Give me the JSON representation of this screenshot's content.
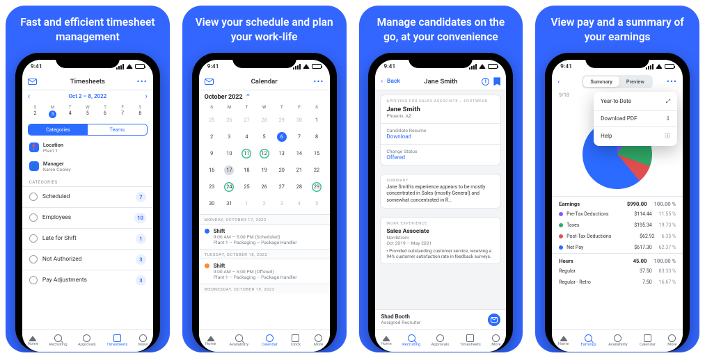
{
  "status_time": "9:41",
  "panels": [
    {
      "headline": "Fast and efficient timesheet management"
    },
    {
      "headline": "View your schedule and plan your work-life"
    },
    {
      "headline": "Manage candidates on the go, at your convenience"
    },
    {
      "headline": "View pay and a summary of your earnings"
    }
  ],
  "timesheets": {
    "title": "Timesheets",
    "range": "Oct 2 – 8, 2022",
    "week_days": [
      "S",
      "M",
      "T",
      "W",
      "T",
      "F",
      "S"
    ],
    "week_dates": [
      "2",
      "3",
      "4",
      "5",
      "6",
      "7",
      "8"
    ],
    "today_index": 1,
    "segments": {
      "left": "Categories",
      "right": "Teams"
    },
    "info": [
      {
        "icon": "📍",
        "label": "Location",
        "value": "Plant 1"
      },
      {
        "icon": "👤",
        "label": "Manager",
        "value": "Karen Cooley"
      }
    ],
    "cat_caption": "CATEGORIES",
    "categories": [
      {
        "name": "Scheduled",
        "count": "7"
      },
      {
        "name": "Employees",
        "count": "10"
      },
      {
        "name": "Late for Shift",
        "count": "1"
      },
      {
        "name": "Not Authorized",
        "count": "3"
      },
      {
        "name": "Pay Adjustments",
        "count": "3"
      }
    ],
    "tabs": [
      "Home",
      "Recruiting",
      "Approvals",
      "Timesheets",
      "More"
    ],
    "active_tab": 3
  },
  "calendar": {
    "title": "Calendar",
    "month": "October 2022",
    "dow": [
      "S",
      "M",
      "T",
      "W",
      "T",
      "F",
      "S"
    ],
    "agenda": [
      {
        "caption": "MONDAY, OCTOBER 17, 2022",
        "color": "blue",
        "title": "Shift",
        "sub1": "9:00 AM – 5:00 PM (Scheduled)",
        "sub2": "Plant 1 – Packaging – Package Handler"
      },
      {
        "caption": "TUESDAY, OCTOBER 18, 2022",
        "color": "orange",
        "title": "Shift",
        "sub1": "9:00 AM – 5:00 PM (Offered)",
        "sub2": "Plant 1 – Packaging – Package Handler"
      },
      {
        "caption": "WEDNESDAY, OCTOBER 19, 2022"
      }
    ],
    "tabs": [
      "Home",
      "Availability",
      "Calendar",
      "Clock",
      "More"
    ],
    "active_tab": 2
  },
  "candidate": {
    "back": "Back",
    "title": "Jane Smith",
    "applying_caption": "APPLYING FOR SALES ASSOCIATE – FOOTWEAR",
    "name": "Jane Smith",
    "location": "Phoenix, AZ",
    "resume_label": "Candidate Resume",
    "resume_link": "Download",
    "status_label": "Change Status",
    "status_value": "Offered",
    "summary_caption": "SUMMARY",
    "summary_text": "Jane Smith's experience appears to be mostly concentrated in Sales (mostly General) and somewhat concentrated in R…",
    "work_caption": "WORK EXPERIENCE",
    "work_title": "Sales Associate",
    "work_company": "Nordstrom",
    "work_dates": "Oct 2019 – May 2021",
    "work_bullet": "• Provided outstanding customer service, receiving a 94% customer satisfaction rate in feedback surveys.",
    "recruiter_name": "Shad Booth",
    "recruiter_role": "Assigned Recruiter",
    "tabs": [
      "Home",
      "Recruiting",
      "Approvals",
      "Timesheets",
      "More"
    ],
    "active_tab": 1
  },
  "pay": {
    "segments": {
      "left": "Summary",
      "right": "Preview"
    },
    "date_label": "9/18",
    "menu": [
      {
        "label": "Year-to-Date",
        "icon": "⤢"
      },
      {
        "label": "Download PDF",
        "icon": "⇩"
      },
      {
        "label": "Help",
        "icon": "ⓘ"
      }
    ],
    "earnings_caption": "Earnings",
    "earnings_total": "$990.00",
    "earnings_pct": "100.00 %",
    "lines": [
      {
        "color": "#7b5cff",
        "label": "Pre-Tax Deductions",
        "amount": "$114.44",
        "pct": "11.55 %"
      },
      {
        "color": "#2fa866",
        "label": "Taxes",
        "amount": "$195.34",
        "pct": "19.73 %"
      },
      {
        "color": "#e04e4e",
        "label": "Post-Tax Deductions",
        "amount": "$62.92",
        "pct": "6.35 %"
      },
      {
        "color": "#2b6bff",
        "label": "Net Pay",
        "amount": "$617.30",
        "pct": "62.37 %"
      }
    ],
    "hours_caption": "Hours",
    "hours_total": "45.00",
    "hours_pct": "100.00 %",
    "hours_lines": [
      {
        "label": "Regular",
        "amount": "37.50",
        "pct": "83.33 %"
      },
      {
        "label": "Regular - Retro",
        "amount": "7.50",
        "pct": "16.67 %"
      }
    ],
    "tabs": [
      "Home",
      "Earnings",
      "Availability",
      "Calendar",
      "More"
    ],
    "active_tab": 1
  },
  "chart_data": {
    "type": "pie",
    "title": "Earnings breakdown",
    "series": [
      {
        "name": "Pre-Tax Deductions",
        "value": 114.44,
        "pct": 11.55,
        "color": "#7b5cff"
      },
      {
        "name": "Taxes",
        "value": 195.34,
        "pct": 19.73,
        "color": "#2fa866"
      },
      {
        "name": "Post-Tax Deductions",
        "value": 62.92,
        "pct": 6.35,
        "color": "#e04e4e"
      },
      {
        "name": "Net Pay",
        "value": 617.3,
        "pct": 62.37,
        "color": "#2b6bff"
      }
    ],
    "total": 990.0
  }
}
